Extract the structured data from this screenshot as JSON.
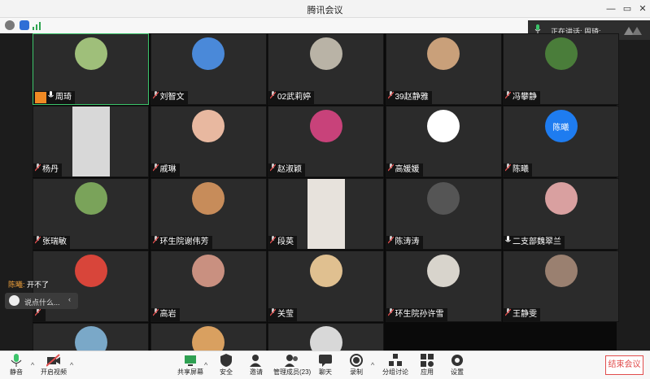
{
  "window": {
    "title": "腾讯会议"
  },
  "speaking_indicator": "正在讲话: 周琦;",
  "participants": [
    {
      "name": "周琦",
      "host": true,
      "muted": false,
      "avatar_color": "#9fbf7a"
    },
    {
      "name": "刘智文",
      "muted": true,
      "avatar_color": "#4a89d9"
    },
    {
      "name": "02武莉婷",
      "muted": true,
      "avatar_color": "#b9b3a6"
    },
    {
      "name": "39赵静雅",
      "muted": true,
      "avatar_color": "#c9a07a"
    },
    {
      "name": "冯攀静",
      "muted": true,
      "avatar_color": "#4a7d3a"
    },
    {
      "name": "杨丹",
      "muted": true,
      "video": true,
      "avatar_color": "#d8d8d8"
    },
    {
      "name": "戚琳",
      "muted": true,
      "avatar_color": "#e8b8a0"
    },
    {
      "name": "赵淑颖",
      "muted": true,
      "avatar_color": "#c8427a"
    },
    {
      "name": "高媛媛",
      "muted": true,
      "avatar_color": "#ffffff"
    },
    {
      "name": "陈曦",
      "muted": true,
      "avatar_color": "#1e7cf0",
      "avatar_text": "陈曦"
    },
    {
      "name": "张瑞敏",
      "muted": true,
      "avatar_color": "#7aa35a"
    },
    {
      "name": "环生院谢伟芳",
      "muted": true,
      "avatar_color": "#c78c5a"
    },
    {
      "name": "段英",
      "muted": true,
      "video": true,
      "avatar_color": "#e7e2dc"
    },
    {
      "name": "陈涛涛",
      "muted": true,
      "avatar_color": "#555555"
    },
    {
      "name": "二支部魏翠兰",
      "muted": false,
      "avatar_color": "#d9a0a0"
    },
    {
      "name": "",
      "muted": true,
      "avatar_color": "#d8453a"
    },
    {
      "name": "高岩",
      "muted": true,
      "avatar_color": "#c99080"
    },
    {
      "name": "关莹",
      "muted": true,
      "avatar_color": "#e0c090"
    },
    {
      "name": "环生院孙许雪",
      "muted": true,
      "avatar_color": "#d8d4cc"
    },
    {
      "name": "王静雯",
      "muted": true,
      "avatar_color": "#9a8070"
    },
    {
      "name": "",
      "muted": false,
      "avatar_color": "#7aa8c8",
      "partial": true
    },
    {
      "name": "",
      "muted": false,
      "avatar_color": "#d9a060",
      "partial": true
    },
    {
      "name": "",
      "muted": false,
      "avatar_color": "#d8d8d8",
      "partial": true
    }
  ],
  "chat": {
    "sender": "陈曦:",
    "message": "开不了",
    "input_placeholder": "说点什么..."
  },
  "toolbar": {
    "mute": "静音",
    "video": "开启视频",
    "share": "共享屏幕",
    "security": "安全",
    "invite": "邀请",
    "members": "管理成员(23)",
    "chat": "聊天",
    "record": "录制",
    "breakout": "分组讨论",
    "apps": "应用",
    "settings": "设置",
    "end": "结束会议"
  },
  "colors": {
    "accent_green": "#3cc46b",
    "end_red": "#e14c4c",
    "tile_bg": "#2b2b2b"
  }
}
